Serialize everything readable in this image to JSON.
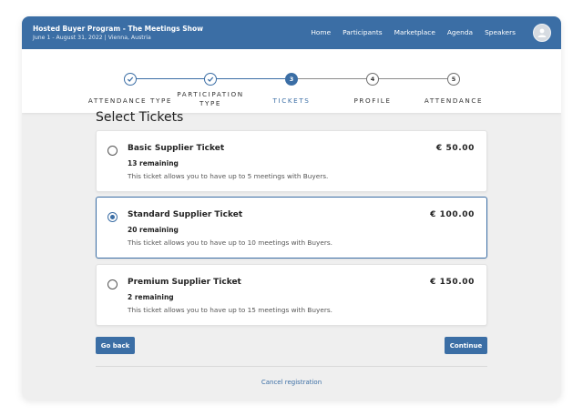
{
  "header": {
    "event_title": "Hosted Buyer Program - The Meetings Show",
    "event_subtitle": "June 1 - August 31, 2022 | Vienna, Austria",
    "nav": [
      "Home",
      "Participants",
      "Marketplace",
      "Agenda",
      "Speakers"
    ],
    "avatar_icon": "user-icon"
  },
  "stepper": {
    "steps": [
      {
        "number": "1",
        "label": "ATTENDANCE TYPE",
        "state": "done"
      },
      {
        "number": "2",
        "label_line1": "PARTICIPATION",
        "label_line2": "TYPE",
        "state": "done"
      },
      {
        "number": "3",
        "label": "TICKETS",
        "state": "active"
      },
      {
        "number": "4",
        "label": "PROFILE",
        "state": "todo"
      },
      {
        "number": "5",
        "label": "ATTENDANCE",
        "state": "todo"
      }
    ]
  },
  "main": {
    "title": "Select Tickets",
    "tickets": [
      {
        "name": "Basic Supplier Ticket",
        "remaining": "13 remaining",
        "description": "This ticket allows you to have up to 5 meetings with Buyers.",
        "price": "€ 50.00",
        "selected": false
      },
      {
        "name": "Standard Supplier Ticket",
        "remaining": "20 remaining",
        "description": "This ticket allows you to have up to 10 meetings with Buyers.",
        "price": "€ 100.00",
        "selected": true
      },
      {
        "name": "Premium Supplier Ticket",
        "remaining": "2 remaining",
        "description": "This ticket allows you to have up to 15 meetings with Buyers.",
        "price": "€ 150.00",
        "selected": false
      }
    ],
    "back_label": "Go back",
    "continue_label": "Continue",
    "cancel_label": "Cancel registration"
  },
  "colors": {
    "primary": "#3b6ea5",
    "background": "#efefef"
  }
}
